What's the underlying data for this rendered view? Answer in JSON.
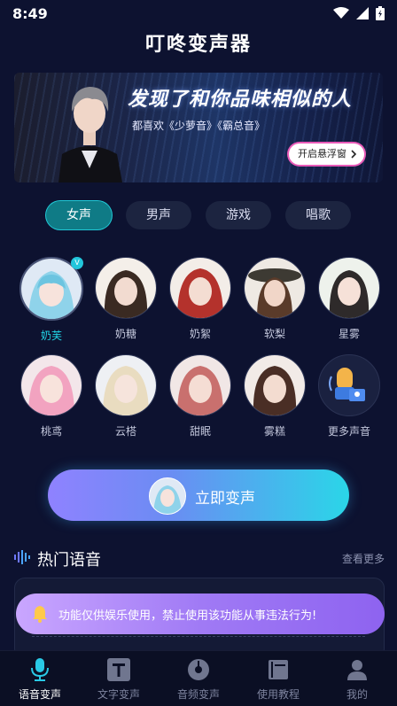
{
  "status": {
    "time": "8:49"
  },
  "app": {
    "title": "叮咚变声器"
  },
  "banner": {
    "headline": "发现了和你品味相似的人",
    "subtitle": "都喜欢《少萝音》《霸总音》",
    "button_label": "开启悬浮窗"
  },
  "tabs": [
    {
      "label": "女声",
      "active": true
    },
    {
      "label": "男声",
      "active": false
    },
    {
      "label": "游戏",
      "active": false
    },
    {
      "label": "唱歌",
      "active": false
    }
  ],
  "voices": [
    {
      "name": "奶芙",
      "selected": true,
      "badge": "V"
    },
    {
      "name": "奶糖"
    },
    {
      "name": "奶絮"
    },
    {
      "name": "软梨"
    },
    {
      "name": "星雾"
    },
    {
      "name": "桃鸢"
    },
    {
      "name": "云榙"
    },
    {
      "name": "甜眠"
    },
    {
      "name": "雾糕"
    },
    {
      "name": "更多声音"
    }
  ],
  "cta": {
    "label": "立即变声"
  },
  "hot_section": {
    "title": "热门语音",
    "more_label": "查看更多"
  },
  "toast": {
    "text": "功能仅供娱乐使用，禁止使用该功能从事违法行为!"
  },
  "bottom_nav": [
    {
      "label": "语音变声",
      "icon": "mic-icon",
      "active": true
    },
    {
      "label": "文字变声",
      "icon": "text-icon"
    },
    {
      "label": "音频变声",
      "icon": "music-disc-icon"
    },
    {
      "label": "使用教程",
      "icon": "book-icon"
    },
    {
      "label": "我的",
      "icon": "profile-icon"
    }
  ],
  "colors": {
    "background": "#0d1230",
    "accent": "#21d3e4",
    "toast": "#a07af5"
  }
}
